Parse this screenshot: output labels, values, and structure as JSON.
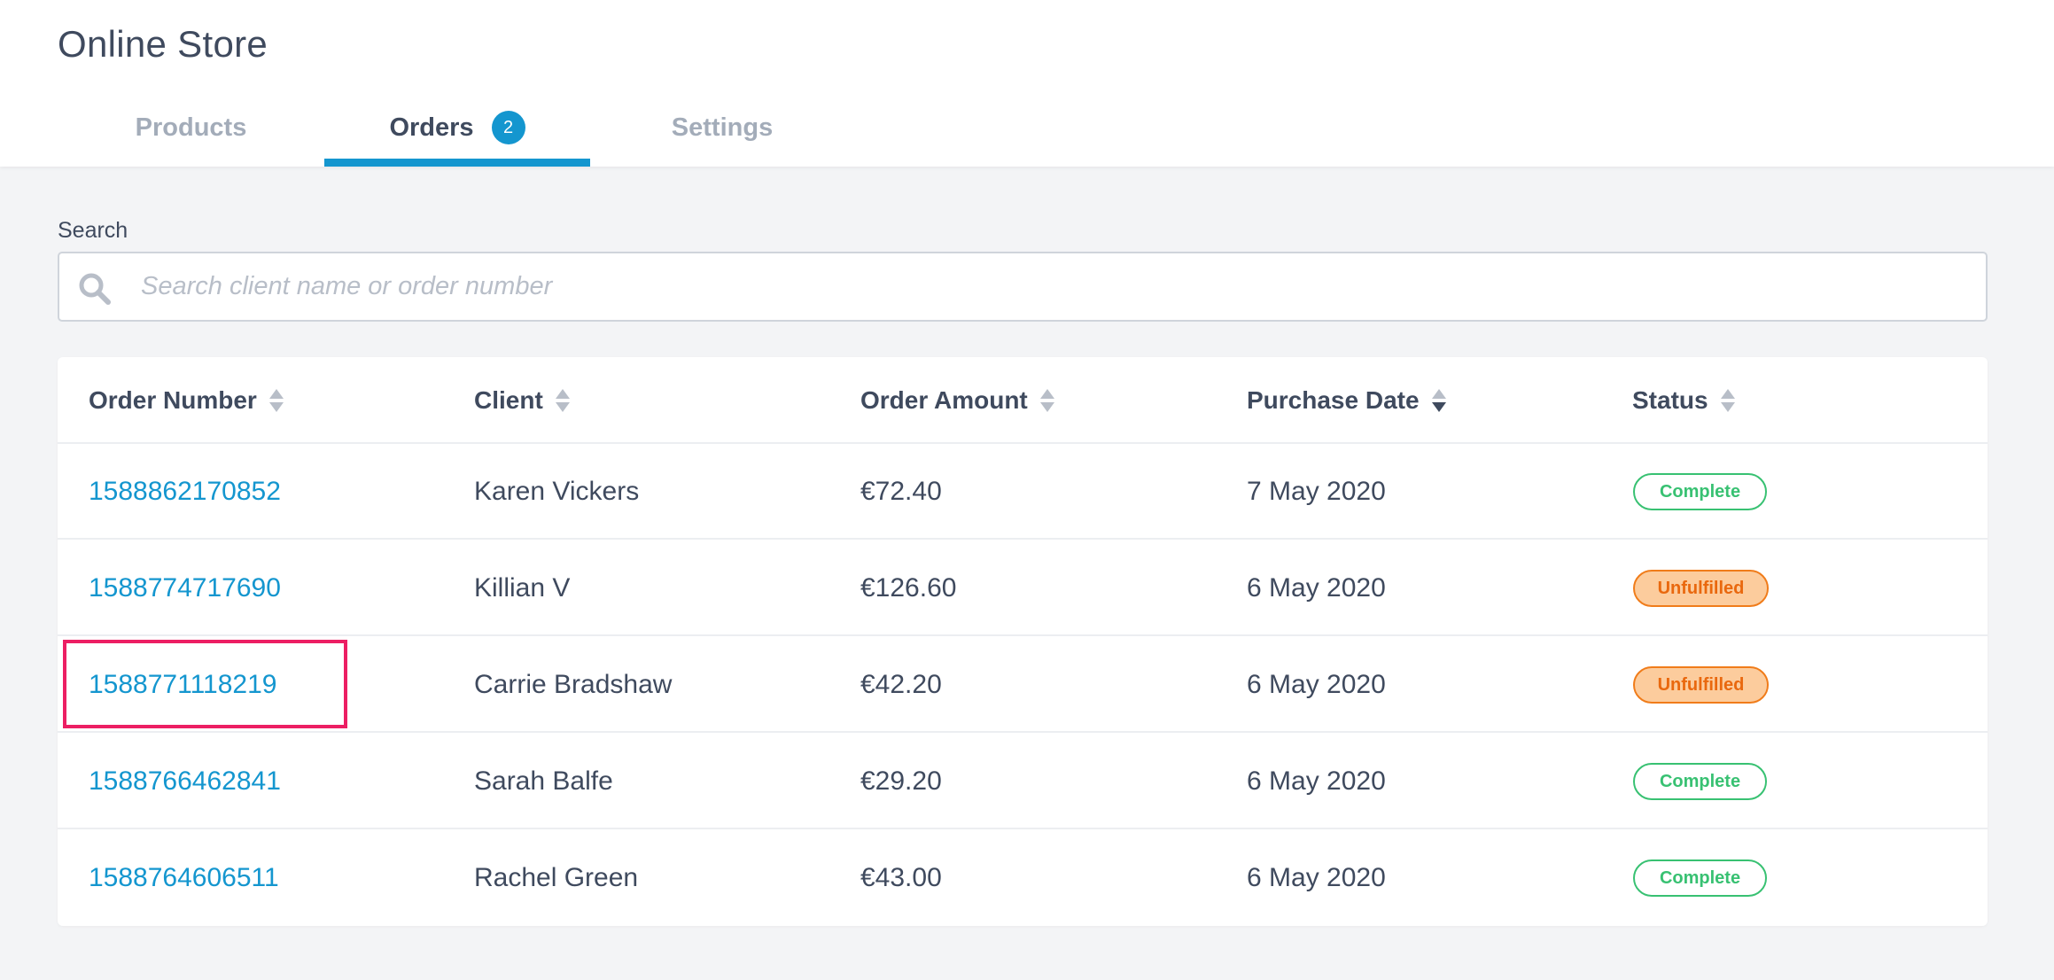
{
  "header": {
    "title": "Online Store",
    "tabs": [
      {
        "label": "Products"
      },
      {
        "label": "Orders",
        "badge": "2"
      },
      {
        "label": "Settings"
      }
    ]
  },
  "search": {
    "label": "Search",
    "placeholder": "Search client name or order number",
    "value": ""
  },
  "table": {
    "columns": [
      "Order Number",
      "Client",
      "Order Amount",
      "Purchase Date",
      "Status"
    ],
    "rows": [
      {
        "order": "1588862170852",
        "client": "Karen Vickers",
        "amount": "€72.40",
        "date": "7 May 2020",
        "status": "Complete"
      },
      {
        "order": "1588774717690",
        "client": "Killian V",
        "amount": "€126.60",
        "date": "6 May 2020",
        "status": "Unfulfilled"
      },
      {
        "order": "1588771118219",
        "client": "Carrie Bradshaw",
        "amount": "€42.20",
        "date": "6 May 2020",
        "status": "Unfulfilled"
      },
      {
        "order": "1588766462841",
        "client": "Sarah Balfe",
        "amount": "€29.20",
        "date": "6 May 2020",
        "status": "Complete"
      },
      {
        "order": "1588764606511",
        "client": "Rachel Green",
        "amount": "€43.00",
        "date": "6 May 2020",
        "status": "Complete"
      }
    ]
  },
  "colors": {
    "accent": "#1496cf",
    "complete": "#38c172",
    "unfulfilled": "#f07c1a",
    "highlight": "#ec1e63"
  }
}
